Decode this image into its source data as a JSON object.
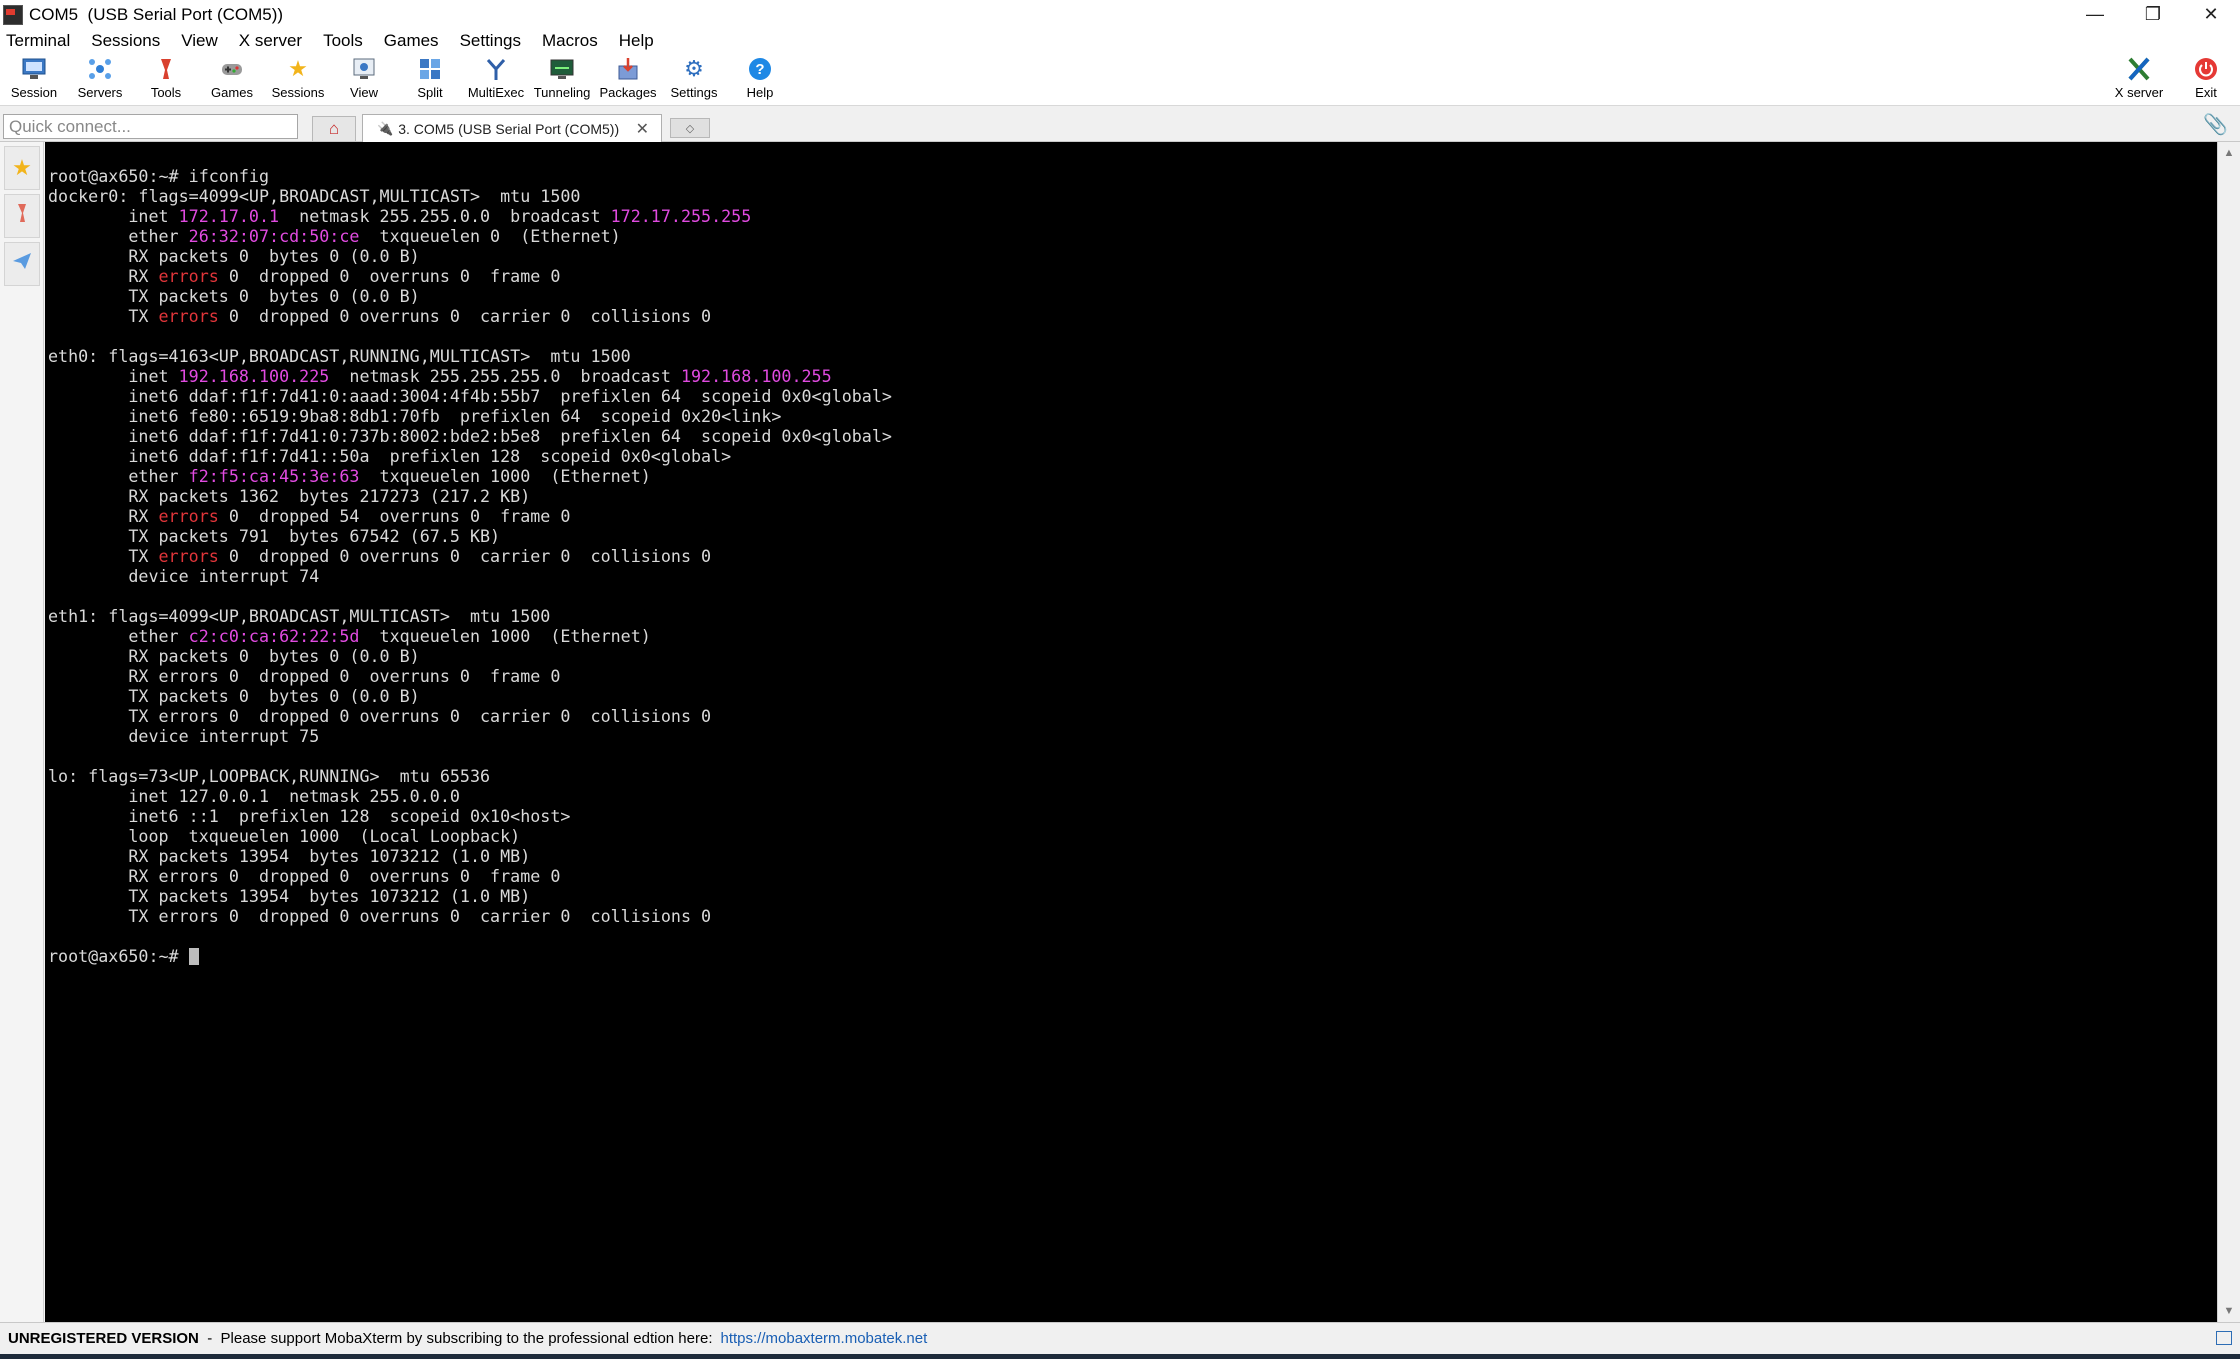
{
  "window": {
    "title": "COM5  (USB Serial Port (COM5))",
    "minimize_glyph": "—",
    "restore_glyph": "❐",
    "close_glyph": "✕"
  },
  "menu": [
    "Terminal",
    "Sessions",
    "View",
    "X server",
    "Tools",
    "Games",
    "Settings",
    "Macros",
    "Help"
  ],
  "toolbar": {
    "left": [
      {
        "label": "Session",
        "icon": "session-icon"
      },
      {
        "label": "Servers",
        "icon": "servers-icon"
      },
      {
        "label": "Tools",
        "icon": "tools-icon"
      },
      {
        "label": "Games",
        "icon": "games-icon"
      },
      {
        "label": "Sessions",
        "icon": "sessions-star-icon"
      },
      {
        "label": "View",
        "icon": "view-icon"
      },
      {
        "label": "Split",
        "icon": "split-icon"
      },
      {
        "label": "MultiExec",
        "icon": "multiexec-icon"
      },
      {
        "label": "Tunneling",
        "icon": "tunneling-icon"
      },
      {
        "label": "Packages",
        "icon": "packages-icon"
      },
      {
        "label": "Settings",
        "icon": "settings-gear-icon"
      },
      {
        "label": "Help",
        "icon": "help-icon"
      }
    ],
    "right": [
      {
        "label": "X server",
        "icon": "x-server-icon"
      },
      {
        "label": "Exit",
        "icon": "exit-power-icon"
      }
    ]
  },
  "quick_connect": {
    "placeholder": "Quick connect..."
  },
  "tab": {
    "label": "3. COM5  (USB Serial Port (COM5))",
    "close": "✕"
  },
  "colors": {
    "accent": "#2d6db5",
    "terminal_bg": "#000000",
    "terminal_fg": "#d9d9d9",
    "highlight_magenta": "#e04be0",
    "highlight_red": "#e0353a"
  },
  "terminal": {
    "lines": [
      [
        {
          "t": "root@ax650:~# ifconfig"
        }
      ],
      [
        {
          "t": "docker0: flags=4099<UP,BROADCAST,MULTICAST>  mtu 1500"
        }
      ],
      [
        {
          "t": "        inet "
        },
        {
          "t": "172.17.0.1",
          "c": "mag"
        },
        {
          "t": "  netmask 255.255.0.0  broadcast "
        },
        {
          "t": "172.17.255.255",
          "c": "mag"
        }
      ],
      [
        {
          "t": "        ether "
        },
        {
          "t": "26:32:07:cd:50:ce",
          "c": "mag"
        },
        {
          "t": "  txqueuelen 0  (Ethernet)"
        }
      ],
      [
        {
          "t": "        RX packets 0  bytes 0 (0.0 B)"
        }
      ],
      [
        {
          "t": "        RX "
        },
        {
          "t": "errors",
          "c": "red"
        },
        {
          "t": " 0  dropped 0  overruns 0  frame 0"
        }
      ],
      [
        {
          "t": "        TX packets 0  bytes 0 (0.0 B)"
        }
      ],
      [
        {
          "t": "        TX "
        },
        {
          "t": "errors",
          "c": "red"
        },
        {
          "t": " 0  dropped 0 overruns 0  carrier 0  collisions 0"
        }
      ],
      [
        {
          "t": ""
        }
      ],
      [
        {
          "t": "eth0: flags=4163<UP,BROADCAST,RUNNING,MULTICAST>  mtu 1500"
        }
      ],
      [
        {
          "t": "        inet "
        },
        {
          "t": "192.168.100.225",
          "c": "mag"
        },
        {
          "t": "  netmask 255.255.255.0  broadcast "
        },
        {
          "t": "192.168.100.255",
          "c": "mag"
        }
      ],
      [
        {
          "t": "        inet6 ddaf:f1f:7d41:0:aaad:3004:4f4b:55b7  prefixlen 64  scopeid 0x0<global>"
        }
      ],
      [
        {
          "t": "        inet6 fe80::6519:9ba8:8db1:70fb  prefixlen 64  scopeid 0x20<link>"
        }
      ],
      [
        {
          "t": "        inet6 ddaf:f1f:7d41:0:737b:8002:bde2:b5e8  prefixlen 64  scopeid 0x0<global>"
        }
      ],
      [
        {
          "t": "        inet6 ddaf:f1f:7d41::50a  prefixlen 128  scopeid 0x0<global>"
        }
      ],
      [
        {
          "t": "        ether "
        },
        {
          "t": "f2:f5:ca:45:3e:63",
          "c": "mag"
        },
        {
          "t": "  txqueuelen 1000  (Ethernet)"
        }
      ],
      [
        {
          "t": "        RX packets 1362  bytes 217273 (217.2 KB)"
        }
      ],
      [
        {
          "t": "        RX "
        },
        {
          "t": "errors",
          "c": "red"
        },
        {
          "t": " 0  dropped 54  overruns 0  frame 0"
        }
      ],
      [
        {
          "t": "        TX packets 791  bytes 67542 (67.5 KB)"
        }
      ],
      [
        {
          "t": "        TX "
        },
        {
          "t": "errors",
          "c": "red"
        },
        {
          "t": " 0  dropped 0 overruns 0  carrier 0  collisions 0"
        }
      ],
      [
        {
          "t": "        device interrupt 74"
        }
      ],
      [
        {
          "t": ""
        }
      ],
      [
        {
          "t": "eth1: flags=4099<UP,BROADCAST,MULTICAST>  mtu 1500"
        }
      ],
      [
        {
          "t": "        ether "
        },
        {
          "t": "c2:c0:ca:62:22:5d",
          "c": "mag"
        },
        {
          "t": "  txqueuelen 1000  (Ethernet)"
        }
      ],
      [
        {
          "t": "        RX packets 0  bytes 0 (0.0 B)"
        }
      ],
      [
        {
          "t": "        RX errors 0  dropped 0  overruns 0  frame 0"
        }
      ],
      [
        {
          "t": "        TX packets 0  bytes 0 (0.0 B)"
        }
      ],
      [
        {
          "t": "        TX errors 0  dropped 0 overruns 0  carrier 0  collisions 0"
        }
      ],
      [
        {
          "t": "        device interrupt 75"
        }
      ],
      [
        {
          "t": ""
        }
      ],
      [
        {
          "t": "lo: flags=73<UP,LOOPBACK,RUNNING>  mtu 65536"
        }
      ],
      [
        {
          "t": "        inet 127.0.0.1  netmask 255.0.0.0"
        }
      ],
      [
        {
          "t": "        inet6 ::1  prefixlen 128  scopeid 0x10<host>"
        }
      ],
      [
        {
          "t": "        loop  txqueuelen 1000  (Local Loopback)"
        }
      ],
      [
        {
          "t": "        RX packets 13954  bytes 1073212 (1.0 MB)"
        }
      ],
      [
        {
          "t": "        RX errors 0  dropped 0  overruns 0  frame 0"
        }
      ],
      [
        {
          "t": "        TX packets 13954  bytes 1073212 (1.0 MB)"
        }
      ],
      [
        {
          "t": "        TX errors 0  dropped 0 overruns 0  carrier 0  collisions 0"
        }
      ],
      [
        {
          "t": ""
        }
      ],
      [
        {
          "t": "root@ax650:~# "
        }
      ]
    ]
  },
  "status": {
    "label": "UNREGISTERED VERSION",
    "message": "  -  Please support MobaXterm by subscribing to the professional edtion here:",
    "link": "https://mobaxterm.mobatek.net"
  }
}
